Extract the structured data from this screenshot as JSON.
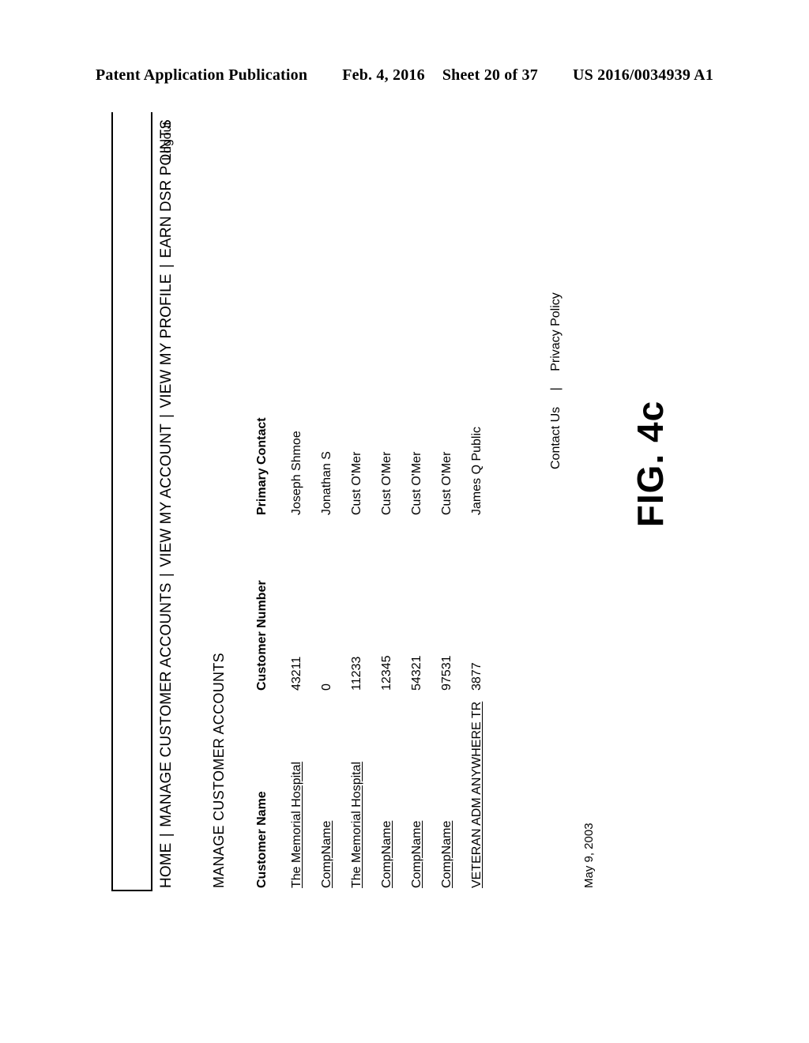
{
  "patent_header": {
    "publication": "Patent Application Publication",
    "date": "Feb. 4, 2016",
    "sheet": "Sheet 20 of 37",
    "number": "US 2016/0034939 A1"
  },
  "figure": {
    "caption": "FIG. 4c"
  },
  "nav": {
    "items": [
      "HOME",
      "MANAGE CUSTOMER ACCOUNTS",
      "VIEW MY ACCOUNT",
      "VIEW MY PROFILE",
      "EARN DSR POINTS"
    ],
    "separator": "|",
    "logout": "Logout"
  },
  "page": {
    "title": "MANAGE CUSTOMER ACCOUNTS",
    "date": "May 9, 2003"
  },
  "table": {
    "headers": [
      "Customer Name",
      "Customer Number",
      "Primary Contact"
    ],
    "rows": [
      {
        "name": "The Memorial Hospital",
        "number": "43211",
        "contact": "Joseph Shmoe"
      },
      {
        "name": "CompName",
        "number": "0",
        "contact": "Jonathan S"
      },
      {
        "name": "The Memorial Hospital",
        "number": "11233",
        "contact": "Cust O'Mer"
      },
      {
        "name": "CompName",
        "number": "12345",
        "contact": "Cust O'Mer"
      },
      {
        "name": "CompName",
        "number": "54321",
        "contact": "Cust O'Mer"
      },
      {
        "name": "CompName",
        "number": "97531",
        "contact": "Cust O'Mer"
      },
      {
        "name": "VETERAN ADM ANYWHERE  TR",
        "number": "3877",
        "contact": "James Q Public"
      }
    ]
  },
  "footer": {
    "contact_us": "Contact Us",
    "separator": "|",
    "privacy_policy": "Privacy Policy"
  }
}
